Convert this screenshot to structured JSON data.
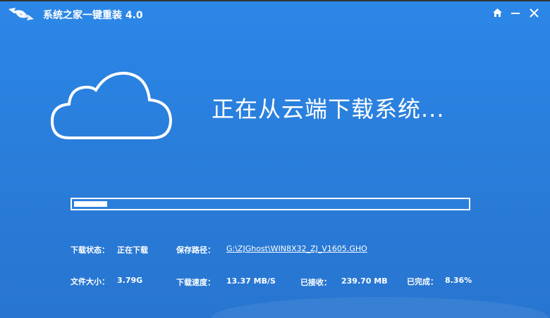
{
  "window": {
    "title": "系统之家一键重装  4.0"
  },
  "controls": {
    "home": "home-icon",
    "minimize": "minimize-icon",
    "close": "close-icon"
  },
  "main": {
    "heading": "正在从云端下载系统...",
    "progress_percent": 8.36
  },
  "info": {
    "status_label": "下载状态：",
    "status_value": "正在下载",
    "path_label": "保存路径：",
    "path_value": "G:\\ZJGhost\\WIN8X32_ZJ_V1605.GHO",
    "size_label": "文件大小：",
    "size_value": "3.79G",
    "speed_label": "下载速度：",
    "speed_value": "13.37 MB/S",
    "received_label": "已接收：",
    "received_value": "239.70 MB",
    "done_label": "已完成：",
    "done_value": "8.36%"
  }
}
